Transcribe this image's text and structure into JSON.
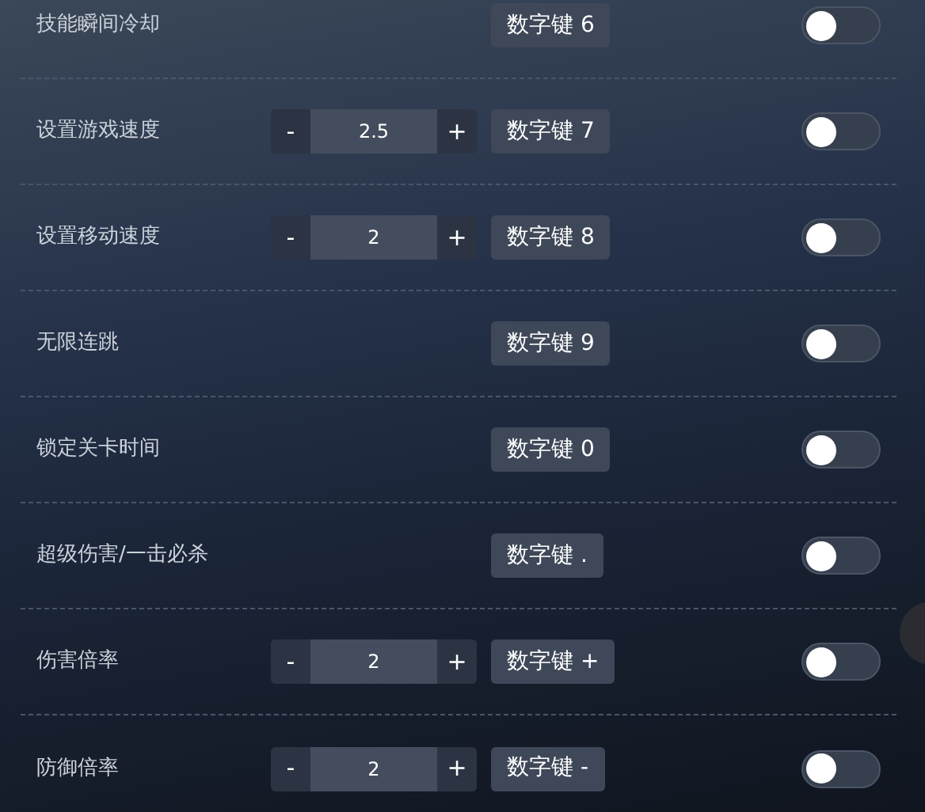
{
  "rows": [
    {
      "label": "技能瞬间冷却",
      "kind": "plain",
      "hotkey": "数字键 6",
      "on": false
    },
    {
      "label": "设置游戏速度",
      "kind": "stepper",
      "minus": "-",
      "value": "2.5",
      "plus": "+",
      "hotkey": "数字键 7",
      "on": false
    },
    {
      "label": "设置移动速度",
      "kind": "stepper",
      "minus": "-",
      "value": "2",
      "plus": "+",
      "hotkey": "数字键 8",
      "on": false
    },
    {
      "label": "无限连跳",
      "kind": "plain",
      "hotkey": "数字键 9",
      "on": false
    },
    {
      "label": "锁定关卡时间",
      "kind": "plain",
      "hotkey": "数字键 0",
      "on": false
    },
    {
      "label": "超级伤害/一击必杀",
      "kind": "plain",
      "hotkey": "数字键 .",
      "on": false
    },
    {
      "label": "伤害倍率",
      "kind": "stepper",
      "minus": "-",
      "value": "2",
      "plus": "+",
      "hotkey": "数字键 +",
      "on": false
    },
    {
      "label": "防御倍率",
      "kind": "stepper",
      "minus": "-",
      "value": "2",
      "plus": "+",
      "hotkey": "数字键 -",
      "on": false
    }
  ]
}
